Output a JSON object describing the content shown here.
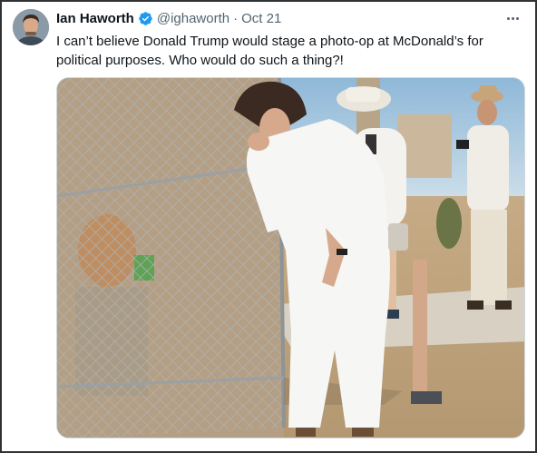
{
  "tweet": {
    "author": {
      "name": "Ian Haworth",
      "handle": "@ighaworth",
      "verified": true,
      "avatar_icon": "user-avatar"
    },
    "separator": "·",
    "date": "Oct 21",
    "text": "I can’t believe Donald Trump would stage a photo-op at McDonald’s for political purposes. Who would do such a thing?!",
    "more_icon": "more-horizontal-icon",
    "media": {
      "type": "photo"
    }
  },
  "colors": {
    "text_primary": "#0f1419",
    "text_secondary": "#536471",
    "verified_badge": "#1d9bf0",
    "frame_border": "#2f3336"
  }
}
